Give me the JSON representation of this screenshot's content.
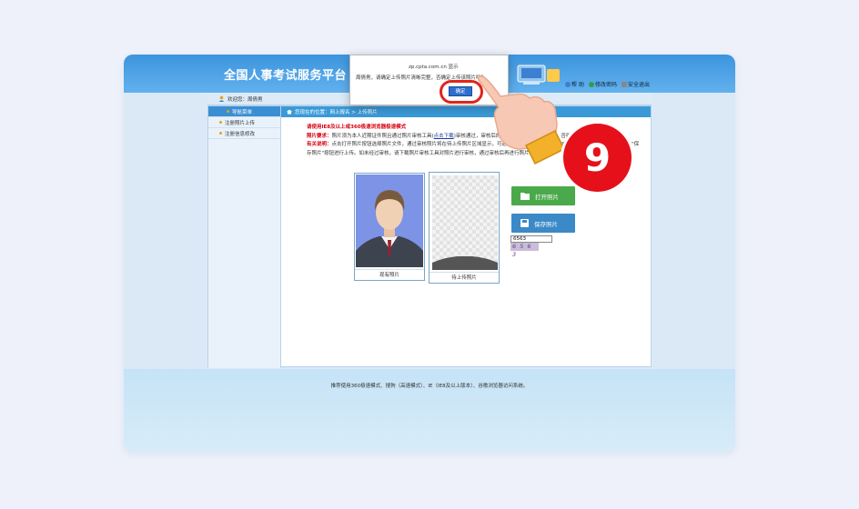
{
  "site": {
    "title": "全国人事考试服务平台",
    "links": [
      "帮 助",
      "修改密码",
      "安全退出"
    ]
  },
  "user": {
    "welcome": "欢迎您：周倩男"
  },
  "sidebar": {
    "items": [
      {
        "label": "导航菜单",
        "active": true
      },
      {
        "label": "注册照片上传",
        "active": false
      },
      {
        "label": "注册信息修改",
        "active": false
      }
    ]
  },
  "breadcrumb": {
    "text": "您现在的位置：网上报名 > 上传照片"
  },
  "notice": {
    "line1": "请使用IE8及以上或360极速浏览器极速模式",
    "req_label": "照片要求：",
    "req_text": "照片须为本人近期证件照且通过照片审核工具(",
    "req_link": "点击下载",
    "req_tail": ")审核通过，审核后的照片不能再进行任何修改，否则照片不存在。",
    "desc_label": "有关说明：",
    "desc_text": "点击打开照片按钮选择照片文件，通过审核照片将在待上传照片区域显示，可通过点击\"保存照片\"按钮完成照片上传，在确认无误后点击\"保存照片\"按钮进行上传。如未经过审核，请下载照片审核工具对照片进行审核，通过审核后再进行照片上传操作。"
  },
  "photos": {
    "current_caption": "现有照片",
    "pending_caption": "待上传照片"
  },
  "buttons": {
    "open": "打开照片",
    "save": "保存照片"
  },
  "captcha": {
    "value": "6563",
    "image_text": "6 5 6 3"
  },
  "footer": {
    "text": "推荐使用360极速模式、搜狗（高速模式）、IE（IE8及以上版本）、谷歌浏览器访问系统。"
  },
  "dialog": {
    "title": "zp.cpta.com.cn 显示",
    "message": "周倩男，请确定上传照片清晰完整，否确定上传该照片吗？",
    "ok_label": "确定"
  },
  "step_badge": "9",
  "colors": {
    "accent": "#3a8fd4",
    "alert": "#e5101a",
    "open_button": "#4aa94a",
    "save_button": "#3b89c7"
  }
}
